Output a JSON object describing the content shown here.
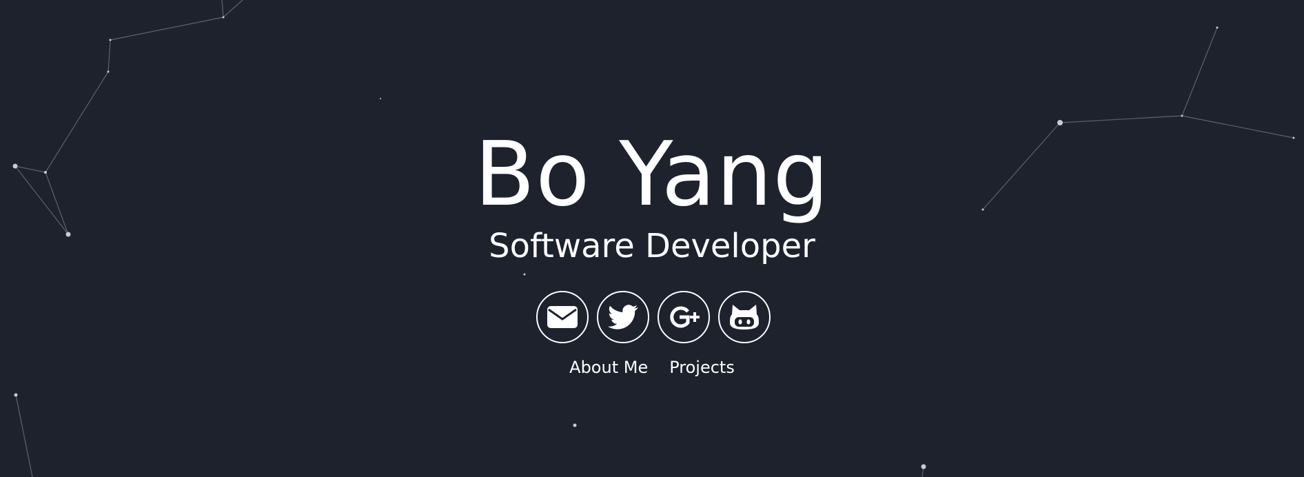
{
  "hero": {
    "name": "Bo Yang",
    "subtitle": "Software Developer"
  },
  "social": [
    {
      "icon": "envelope-icon",
      "label": "Email"
    },
    {
      "icon": "twitter-bird-icon",
      "label": "Twitter"
    },
    {
      "icon": "google-plus-icon",
      "label": "Google+"
    },
    {
      "icon": "github-octocat-icon",
      "label": "GitHub"
    }
  ],
  "nav": {
    "about_label": "About Me",
    "projects_label": "Projects"
  },
  "colors": {
    "background": "#1d222d",
    "foreground": "#ffffff",
    "particle_line": "#5c6270",
    "particle_dot": "#c9ccd2"
  }
}
